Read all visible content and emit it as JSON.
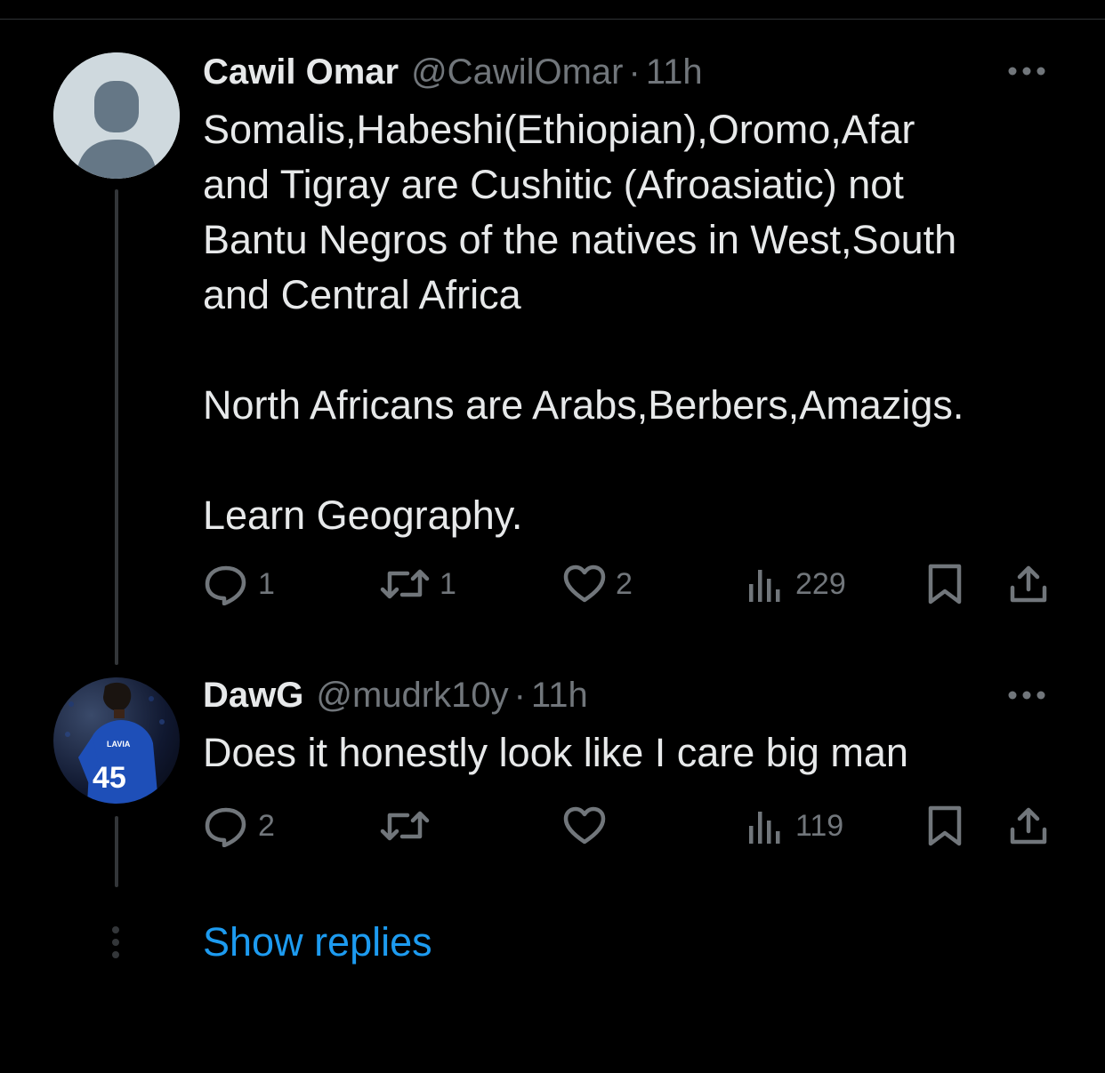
{
  "tweets": [
    {
      "name": "Cawil Omar",
      "handle": "@CawilOmar",
      "separator": "·",
      "time": "11h",
      "text": "Somalis,Habeshi(Ethiopian),Oromo,Afar\nand Tigray are Cushitic (Afroasiatic) not\nBantu Negros of the natives in West,South\nand Central Africa\n\nNorth Africans are Arabs,Berbers,Amazigs.\n\nLearn Geography.",
      "avatar_icon": "default-profile-icon",
      "replies": "1",
      "retweets": "1",
      "likes": "2",
      "views": "229"
    },
    {
      "name": "DawG",
      "handle": "@mudrk10y",
      "separator": "·",
      "time": "11h",
      "text": "Does it honestly look like I care big man",
      "avatar_icon": "footballer-photo-avatar",
      "avatar_jersey_number": "45",
      "avatar_jersey_name": "LAVIA",
      "replies": "2",
      "retweets": "",
      "likes": "",
      "views": "119"
    }
  ],
  "show_replies_label": "Show replies",
  "colors": {
    "background": "#000000",
    "text_primary": "#e7e9ea",
    "text_secondary": "#71767b",
    "link": "#1d9bf0",
    "thread_line": "#333639"
  }
}
